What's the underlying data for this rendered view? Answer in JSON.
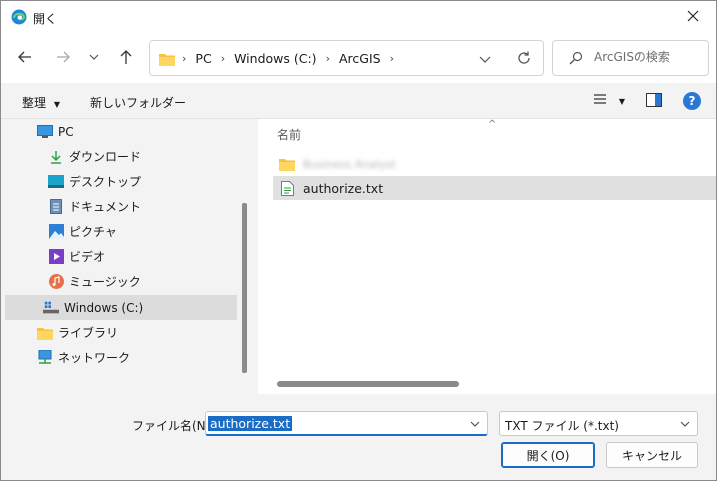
{
  "window": {
    "title": "開く"
  },
  "navigation": {
    "breadcrumbs": [
      "PC",
      "Windows (C:)",
      "ArcGIS"
    ],
    "search_placeholder": "ArcGISの検索"
  },
  "toolbar": {
    "organize_label": "整理",
    "new_folder_label": "新しいフォルダー"
  },
  "sidebar": {
    "items": [
      {
        "label": "PC",
        "icon": "pc-icon"
      },
      {
        "label": "ダウンロード",
        "icon": "download-icon"
      },
      {
        "label": "デスクトップ",
        "icon": "desktop-icon"
      },
      {
        "label": "ドキュメント",
        "icon": "document-icon"
      },
      {
        "label": "ピクチャ",
        "icon": "pictures-icon"
      },
      {
        "label": "ビデオ",
        "icon": "video-icon"
      },
      {
        "label": "ミュージック",
        "icon": "music-icon"
      },
      {
        "label": "Windows (C:)",
        "icon": "drive-icon",
        "selected": true
      },
      {
        "label": "ライブラリ",
        "icon": "library-icon"
      },
      {
        "label": "ネットワーク",
        "icon": "network-icon"
      }
    ]
  },
  "file_list": {
    "column_name": "名前",
    "items": [
      {
        "name": "Business Analyst",
        "type": "folder",
        "blurred": true
      },
      {
        "name": "authorize.txt",
        "type": "text-file",
        "selected": true
      }
    ]
  },
  "footer": {
    "filename_label": "ファイル名(N):",
    "filename_value": "authorize.txt",
    "filetype_value": "TXT ファイル (*.txt)",
    "open_label": "開く(O)",
    "cancel_label": "キャンセル"
  },
  "colors": {
    "accent": "#1a6cc4",
    "folder": "#f5c242"
  }
}
